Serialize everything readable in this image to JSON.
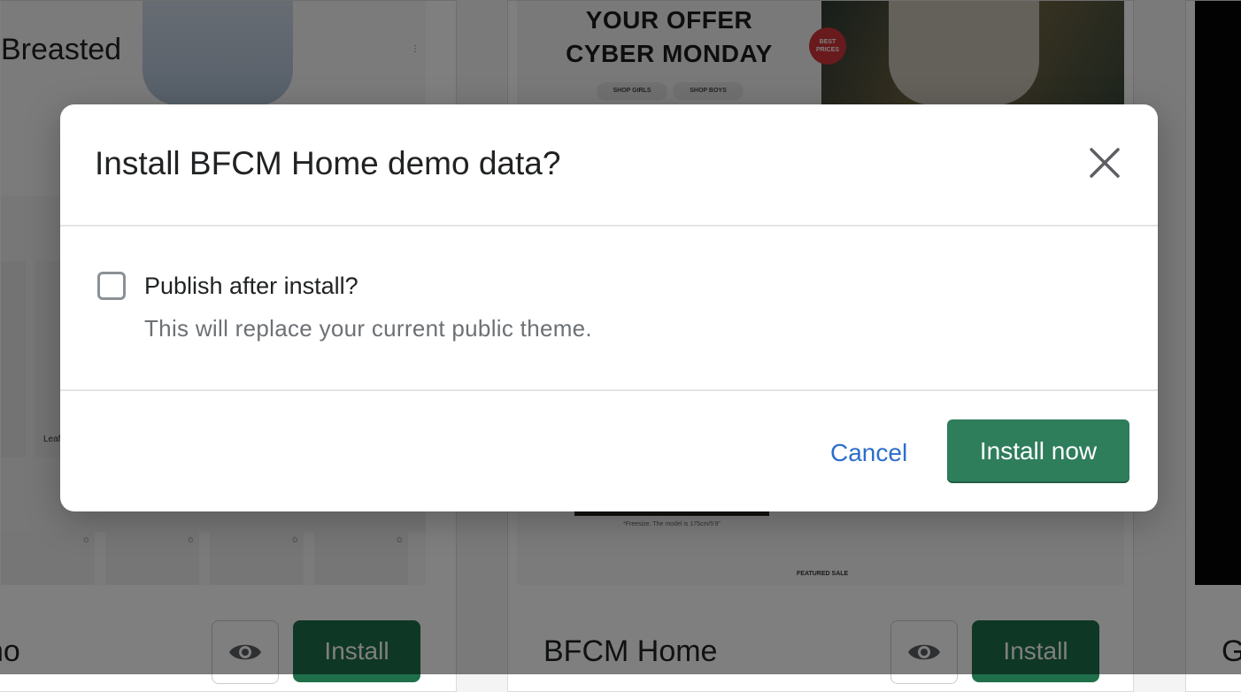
{
  "background": {
    "left_card": {
      "heading_fragment": "Breasted",
      "tile_label": "Leaf",
      "theme_name": "no",
      "install_label": "Install"
    },
    "middle_card": {
      "banner_line1": "YOUR OFFER",
      "banner_line2": "CYBER MONDAY",
      "shop_girls": "SHOP GIRLS",
      "shop_boys": "SHOP BOYS",
      "badge_line1": "BEST",
      "badge_line2": "PRICES",
      "freesize_note": "*Freesize. The model is 175cm/5'9\"",
      "featured_label": "FEATURED SALE",
      "theme_name": "BFCM Home",
      "install_label": "Install"
    },
    "right_card": {
      "theme_name": "G"
    }
  },
  "modal": {
    "title": "Install BFCM Home demo data?",
    "checkbox": {
      "label": "Publish after install?",
      "help": "This will replace your current public theme.",
      "checked": false
    },
    "cancel_label": "Cancel",
    "primary_label": "Install now",
    "colors": {
      "primary": "#2e7d5b",
      "link": "#2c6ecb"
    }
  }
}
